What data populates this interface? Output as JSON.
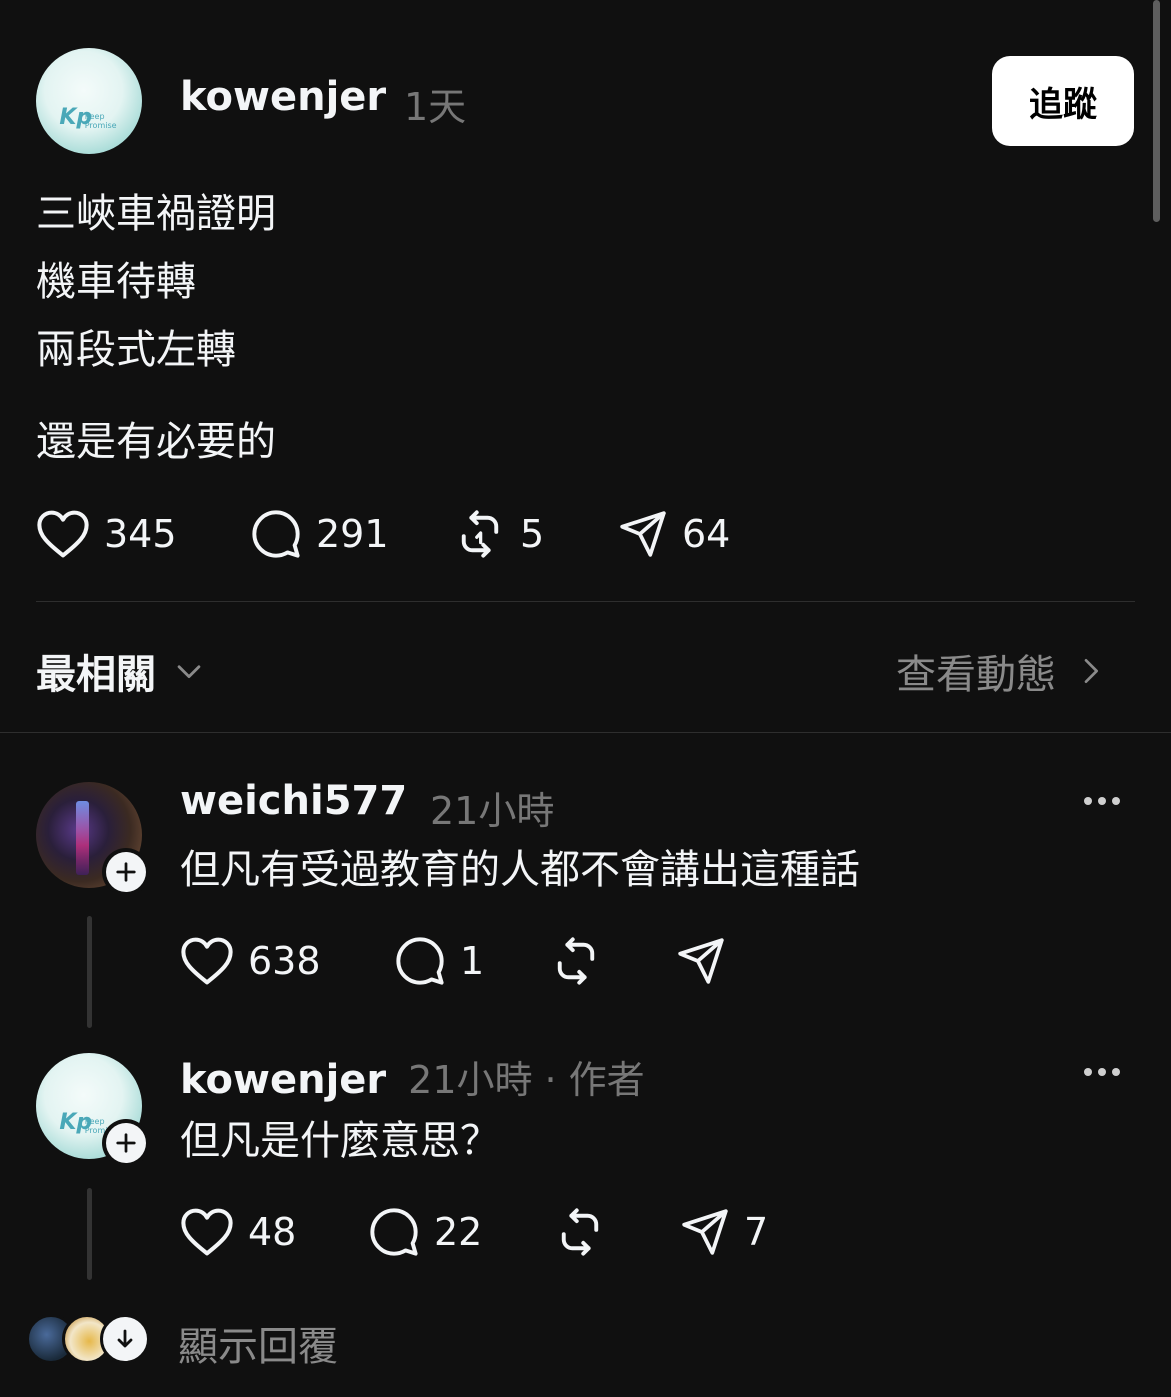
{
  "post": {
    "author": "kowenjer",
    "time": "1天",
    "follow_label": "追蹤",
    "avatar_text": {
      "mark": "Kp",
      "line1": "Keep",
      "line2": "Promise"
    },
    "lines": [
      "三峽車禍證明",
      "機車待轉",
      "兩段式左轉",
      "還是有必要的"
    ],
    "likes": "345",
    "comments": "291",
    "reposts": "5",
    "shares": "64"
  },
  "sort": {
    "label": "最相關",
    "view_activity": "查看動態"
  },
  "replies": [
    {
      "author": "weichi577",
      "time": "21小時",
      "text": "但凡有受過教育的人都不會講出這種話",
      "likes": "638",
      "comments": "1",
      "reposts": "",
      "shares": ""
    },
    {
      "author": "kowenjer",
      "time": "21小時",
      "author_tag": "作者",
      "separator": "·",
      "text": "但凡是什麼意思？",
      "likes": "48",
      "comments": "22",
      "reposts": "",
      "shares": "7"
    }
  ],
  "show_replies_label": "顯示回覆",
  "icons": [
    "heart-icon",
    "comment-icon",
    "repost-icon",
    "share-icon",
    "chevron-down-icon",
    "chevron-right-icon",
    "more-icon",
    "plus-icon",
    "arrow-down-icon"
  ],
  "colors": {
    "background": "#101010",
    "text": "#f3f5f7",
    "muted": "#777777",
    "button_bg": "#ffffff"
  }
}
